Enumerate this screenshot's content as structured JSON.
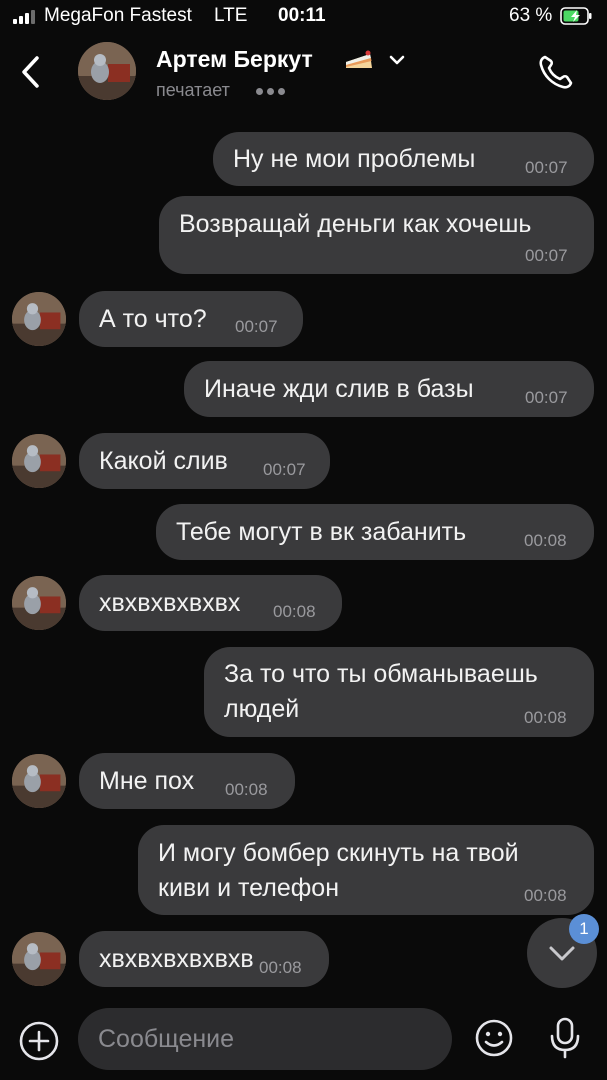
{
  "status_bar": {
    "carrier": "MegaFon Fastest",
    "network": "LTE",
    "time": "00:11",
    "battery": "63 %"
  },
  "header": {
    "name": "Артем Беркут",
    "status": "печатает"
  },
  "messages": [
    {
      "side": "out",
      "text": "Ну не мои проблемы",
      "time": "00:07"
    },
    {
      "side": "out",
      "text": "Возвращай деньги как хочешь",
      "time": "00:07"
    },
    {
      "side": "in",
      "text": "А то что?",
      "time": "00:07"
    },
    {
      "side": "out",
      "text": "Иначе жди слив в базы",
      "time": "00:07"
    },
    {
      "side": "in",
      "text": "Какой слив",
      "time": "00:07"
    },
    {
      "side": "out",
      "text": "Тебе могут в вк забанить",
      "time": "00:08"
    },
    {
      "side": "in",
      "text": "хвхвхвхвхвх",
      "time": "00:08"
    },
    {
      "side": "out",
      "lines": [
        "За то что ты обманываешь",
        "людей"
      ],
      "time": "00:08"
    },
    {
      "side": "in",
      "text": "Мне пох",
      "time": "00:08"
    },
    {
      "side": "out",
      "lines": [
        "И могу бомбер скинуть на твой",
        "киви и телефон"
      ],
      "time": "00:08"
    },
    {
      "side": "in",
      "text": "хвхвхвхвхвхв",
      "time": "00:08"
    }
  ],
  "scroll_fab": {
    "badge": "1",
    "icon": "chevron-down-icon"
  },
  "composer": {
    "placeholder": "Сообщение"
  },
  "colors": {
    "background": "#0a0a0a",
    "bubble": "#3a3a3c",
    "badge": "#5b8fd6",
    "battery": "#4cd964"
  }
}
